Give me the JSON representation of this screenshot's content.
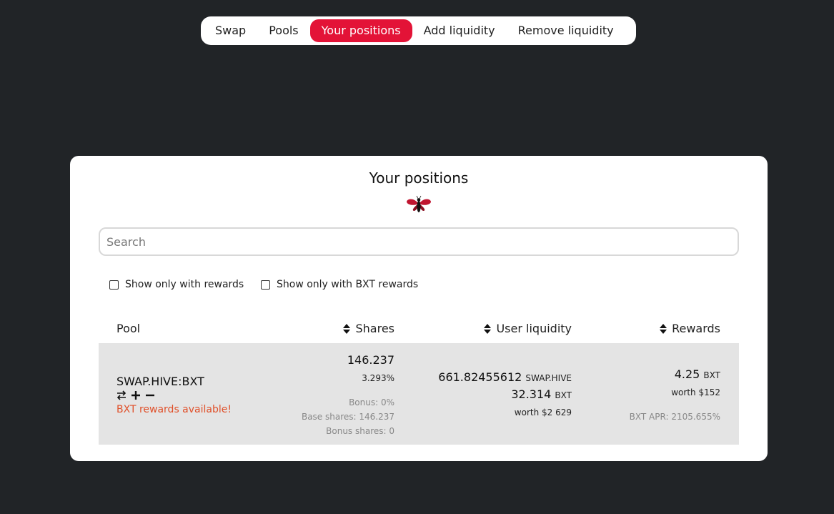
{
  "nav": {
    "items": [
      {
        "label": "Swap"
      },
      {
        "label": "Pools"
      },
      {
        "label": "Your positions",
        "active": true
      },
      {
        "label": "Add liquidity"
      },
      {
        "label": "Remove liquidity"
      }
    ]
  },
  "card": {
    "title": "Your positions",
    "logo_icon": "bee-logo-icon"
  },
  "search": {
    "placeholder": "Search",
    "value": ""
  },
  "filters": {
    "rewards_label": "Show only with rewards",
    "bxt_rewards_label": "Show only with BXT rewards",
    "rewards_checked": false,
    "bxt_rewards_checked": false
  },
  "table": {
    "headers": {
      "pool": "Pool",
      "shares": "Shares",
      "user_liquidity": "User liquidity",
      "rewards": "Rewards"
    },
    "rows": [
      {
        "pool": "SWAP.HIVE:BXT",
        "rewards_notice": "BXT rewards available!",
        "shares": "146.237",
        "shares_pct": "3.293%",
        "bonus": "Bonus: 0%",
        "base_shares": "Base shares: 146.237",
        "bonus_shares": "Bonus shares: 0",
        "liq_amount_1": "661.82455612",
        "liq_token_1": "SWAP.HIVE",
        "liq_amount_2": "32.314",
        "liq_token_2": "BXT",
        "liq_worth": "worth $2 629",
        "reward_amount": "4.25",
        "reward_token": "BXT",
        "reward_worth": "worth $152",
        "apr": "BXT APR: 2105.655%"
      }
    ]
  },
  "colors": {
    "background": "#212427",
    "accent": "#e31337",
    "notice": "#e0502a",
    "row_bg": "#e4e4e4"
  }
}
